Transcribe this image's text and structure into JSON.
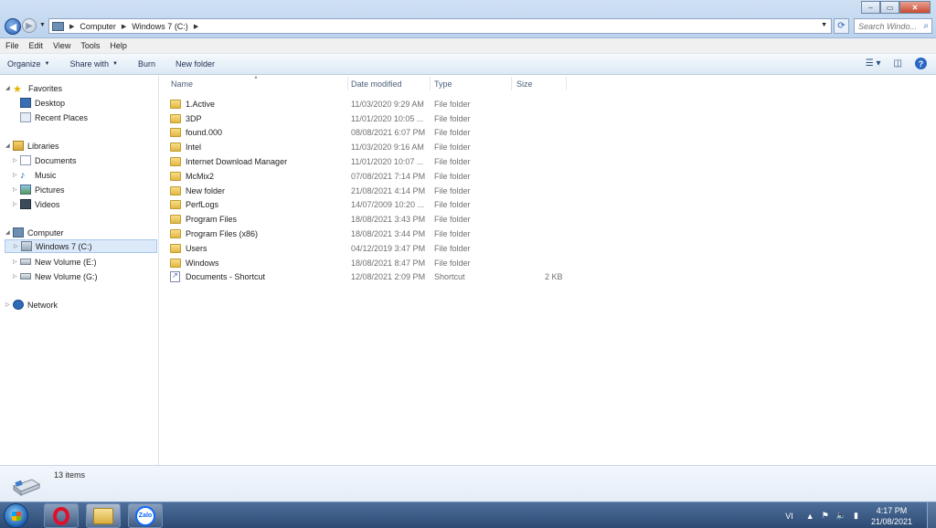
{
  "window": {
    "breadcrumb": [
      "Computer",
      "Windows 7 (C:)"
    ],
    "search_placeholder": "Search Windo...",
    "controls": {
      "minimize": "–",
      "maximize": "▭",
      "close": "✕"
    }
  },
  "menu": [
    "File",
    "Edit",
    "View",
    "Tools",
    "Help"
  ],
  "toolbar": {
    "organize": "Organize",
    "share_with": "Share with",
    "burn": "Burn",
    "new_folder": "New folder"
  },
  "nav": {
    "favorites": "Favorites",
    "desktop": "Desktop",
    "recent_places": "Recent Places",
    "libraries": "Libraries",
    "documents": "Documents",
    "music": "Music",
    "pictures": "Pictures",
    "videos": "Videos",
    "computer": "Computer",
    "drive_c": "Windows 7 (C:)",
    "drive_e": "New Volume (E:)",
    "drive_g": "New Volume (G:)",
    "network": "Network"
  },
  "columns": {
    "name": "Name",
    "date": "Date modified",
    "type": "Type",
    "size": "Size"
  },
  "files": [
    {
      "name": "1.Active",
      "date": "11/03/2020 9:29 AM",
      "type": "File folder",
      "size": "",
      "icon": "folder-icon"
    },
    {
      "name": "3DP",
      "date": "11/01/2020 10:05 ...",
      "type": "File folder",
      "size": "",
      "icon": "folder-icon"
    },
    {
      "name": "found.000",
      "date": "08/08/2021 6:07 PM",
      "type": "File folder",
      "size": "",
      "icon": "folder-icon"
    },
    {
      "name": "Intel",
      "date": "11/03/2020 9:16 AM",
      "type": "File folder",
      "size": "",
      "icon": "folder-icon"
    },
    {
      "name": "Internet Download Manager",
      "date": "11/01/2020 10:07 ...",
      "type": "File folder",
      "size": "",
      "icon": "folder-icon"
    },
    {
      "name": "McMix2",
      "date": "07/08/2021 7:14 PM",
      "type": "File folder",
      "size": "",
      "icon": "folder-icon"
    },
    {
      "name": "New folder",
      "date": "21/08/2021 4:14 PM",
      "type": "File folder",
      "size": "",
      "icon": "folder-icon"
    },
    {
      "name": "PerfLogs",
      "date": "14/07/2009 10:20 ...",
      "type": "File folder",
      "size": "",
      "icon": "folder-icon"
    },
    {
      "name": "Program Files",
      "date": "18/08/2021 3:43 PM",
      "type": "File folder",
      "size": "",
      "icon": "folder-icon"
    },
    {
      "name": "Program Files (x86)",
      "date": "18/08/2021 3:44 PM",
      "type": "File folder",
      "size": "",
      "icon": "folder-icon"
    },
    {
      "name": "Users",
      "date": "04/12/2019 3:47 PM",
      "type": "File folder",
      "size": "",
      "icon": "folder-icon"
    },
    {
      "name": "Windows",
      "date": "18/08/2021 8:47 PM",
      "type": "File folder",
      "size": "",
      "icon": "folder-icon"
    },
    {
      "name": "Documents - Shortcut",
      "date": "12/08/2021 2:09 PM",
      "type": "Shortcut",
      "size": "2 KB",
      "icon": "shortcut-icon"
    }
  ],
  "status": {
    "item_count": "13 items"
  },
  "taskbar": {
    "zalo_label": "Zalo",
    "language": "VI",
    "time": "4:17 PM",
    "date": "21/08/2021"
  }
}
